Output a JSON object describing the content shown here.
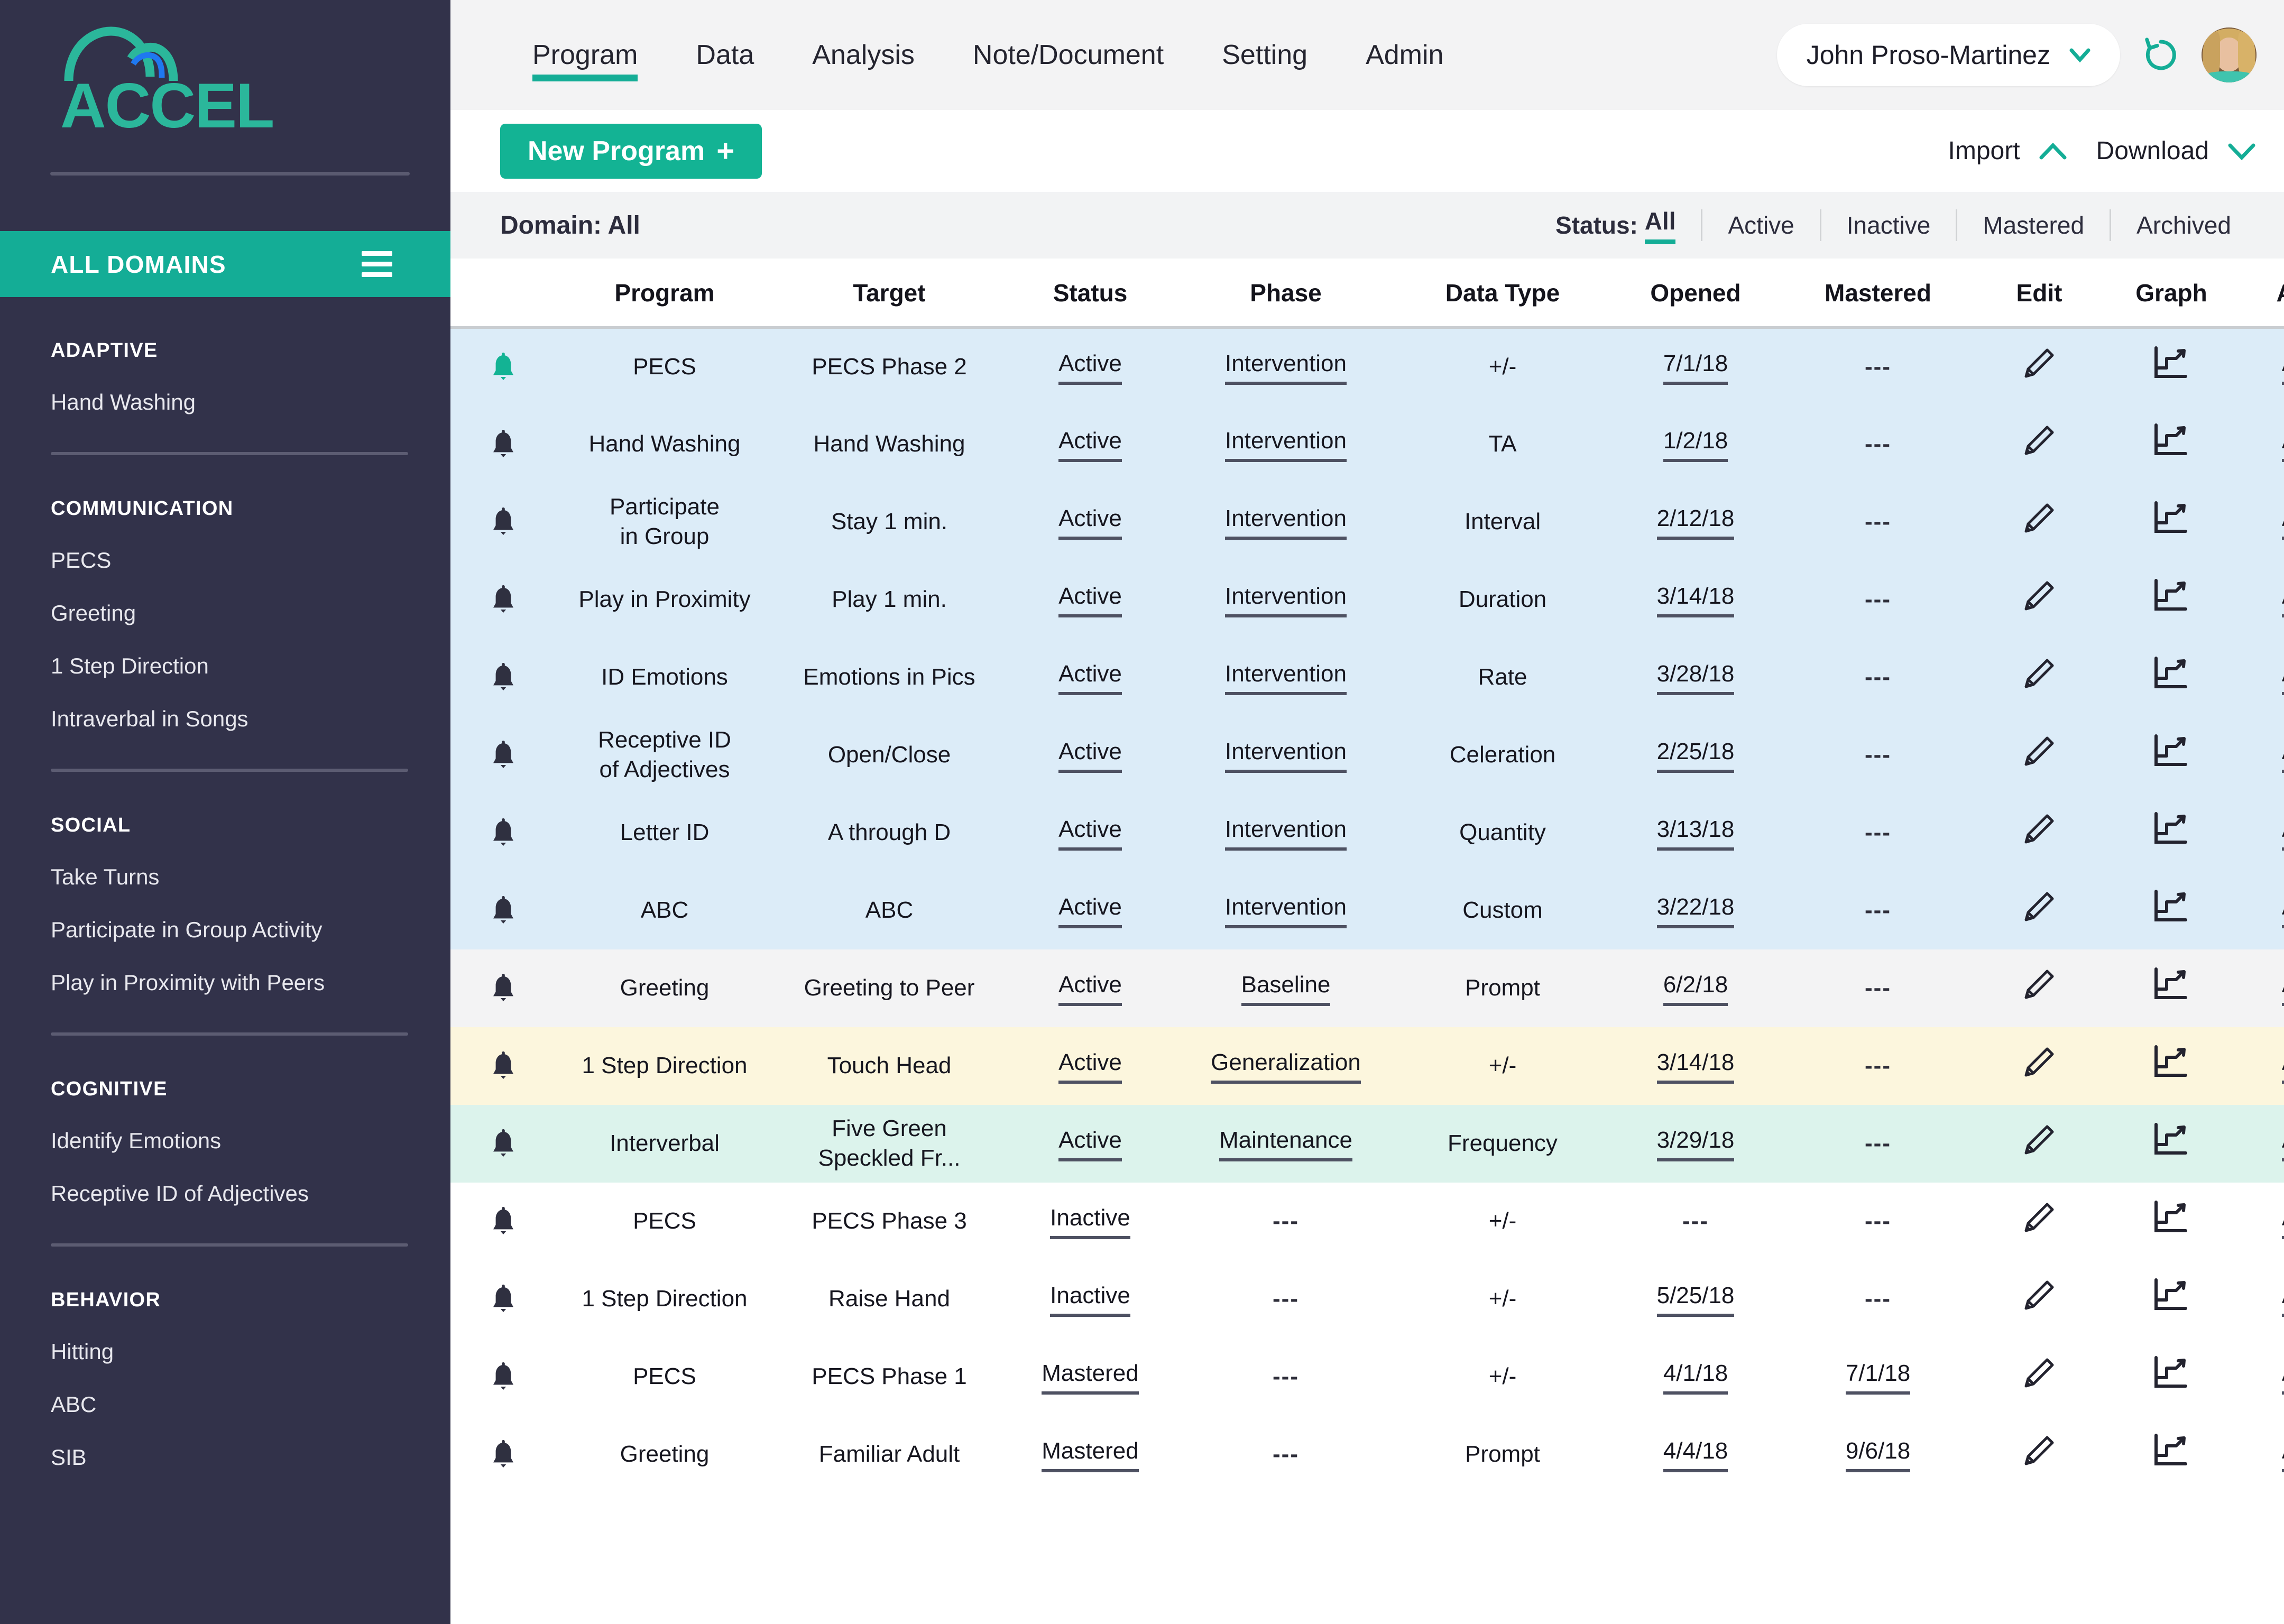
{
  "brand": {
    "name": "ACCEL"
  },
  "sidebar": {
    "all_domains_label": "ALL DOMAINS",
    "groups": [
      {
        "title": "ADAPTIVE",
        "items": [
          "Hand Washing"
        ]
      },
      {
        "title": "COMMUNICATION",
        "items": [
          "PECS",
          "Greeting",
          "1 Step Direction",
          "Intraverbal in Songs"
        ]
      },
      {
        "title": "SOCIAL",
        "items": [
          "Take Turns",
          "Participate in Group Activity",
          "Play in Proximity with Peers"
        ]
      },
      {
        "title": "COGNITIVE",
        "items": [
          "Identify Emotions",
          "Receptive ID of Adjectives"
        ]
      },
      {
        "title": "BEHAVIOR",
        "items": [
          "Hitting",
          "ABC",
          "SIB"
        ]
      }
    ]
  },
  "topnav": {
    "tabs": [
      {
        "label": "Program",
        "active": true
      },
      {
        "label": "Data",
        "active": false
      },
      {
        "label": "Analysis",
        "active": false
      },
      {
        "label": "Note/Document",
        "active": false
      },
      {
        "label": "Setting",
        "active": false
      },
      {
        "label": "Admin",
        "active": false
      }
    ],
    "user_name": "John Proso-Martinez"
  },
  "toolbar": {
    "new_program_label": "New Program",
    "new_program_plus": "+",
    "import_label": "Import",
    "download_label": "Download"
  },
  "filters": {
    "domain_label": "Domain: All",
    "status_prefix": "Status:",
    "status_selected": "All",
    "status_options": [
      "Active",
      "Inactive",
      "Mastered",
      "Archived"
    ]
  },
  "table": {
    "columns": [
      "",
      "Program",
      "Target",
      "Status",
      "Phase",
      "Data Type",
      "Opened",
      "Mastered",
      "Edit",
      "Graph",
      "Action"
    ],
    "action_label": "Action",
    "empty_value": "---",
    "rows": [
      {
        "row_style": "r-intervention",
        "bell": "active",
        "program": "PECS",
        "target": "PECS Phase 2",
        "status": "Active",
        "phase": "Intervention",
        "data_type": "+/-",
        "opened": "7/1/18",
        "mastered": "---"
      },
      {
        "row_style": "r-intervention",
        "bell": "normal",
        "program": "Hand Washing",
        "target": "Hand Washing",
        "status": "Active",
        "phase": "Intervention",
        "data_type": "TA",
        "opened": "1/2/18",
        "mastered": "---"
      },
      {
        "row_style": "r-intervention",
        "bell": "normal",
        "program": "Participate\nin Group",
        "target": "Stay 1 min.",
        "status": "Active",
        "phase": "Intervention",
        "data_type": "Interval",
        "opened": "2/12/18",
        "mastered": "---"
      },
      {
        "row_style": "r-intervention",
        "bell": "normal",
        "program": "Play in Proximity",
        "target": "Play 1 min.",
        "status": "Active",
        "phase": "Intervention",
        "data_type": "Duration",
        "opened": "3/14/18",
        "mastered": "---"
      },
      {
        "row_style": "r-intervention",
        "bell": "normal",
        "program": "ID Emotions",
        "target": "Emotions in Pics",
        "status": "Active",
        "phase": "Intervention",
        "data_type": "Rate",
        "opened": "3/28/18",
        "mastered": "---"
      },
      {
        "row_style": "r-intervention",
        "bell": "normal",
        "program": "Receptive ID\nof Adjectives",
        "target": "Open/Close",
        "status": "Active",
        "phase": "Intervention",
        "data_type": "Celeration",
        "opened": "2/25/18",
        "mastered": "---"
      },
      {
        "row_style": "r-intervention",
        "bell": "normal",
        "program": "Letter ID",
        "target": "A through D",
        "status": "Active",
        "phase": "Intervention",
        "data_type": "Quantity",
        "opened": "3/13/18",
        "mastered": "---"
      },
      {
        "row_style": "r-intervention",
        "bell": "normal",
        "program": "ABC",
        "target": "ABC",
        "status": "Active",
        "phase": "Intervention",
        "data_type": "Custom",
        "opened": "3/22/18",
        "mastered": "---"
      },
      {
        "row_style": "r-baseline",
        "bell": "normal",
        "program": "Greeting",
        "target": "Greeting to Peer",
        "status": "Active",
        "phase": "Baseline",
        "data_type": "Prompt",
        "opened": "6/2/18",
        "mastered": "---"
      },
      {
        "row_style": "r-generalization",
        "bell": "normal",
        "program": "1 Step Direction",
        "target": "Touch Head",
        "status": "Active",
        "phase": "Generalization",
        "data_type": "+/-",
        "opened": "3/14/18",
        "mastered": "---"
      },
      {
        "row_style": "r-maintenance",
        "bell": "normal",
        "program": "Interverbal",
        "target": "Five Green\nSpeckled Fr...",
        "status": "Active",
        "phase": "Maintenance",
        "data_type": "Frequency",
        "opened": "3/29/18",
        "mastered": "---"
      },
      {
        "row_style": "r-plain",
        "bell": "normal",
        "program": "PECS",
        "target": "PECS Phase 3",
        "status": "Inactive",
        "phase": "---",
        "data_type": "+/-",
        "opened": "---",
        "mastered": "---"
      },
      {
        "row_style": "r-plain",
        "bell": "normal",
        "program": "1 Step Direction",
        "target": "Raise Hand",
        "status": "Inactive",
        "phase": "---",
        "data_type": "+/-",
        "opened": "5/25/18",
        "mastered": "---"
      },
      {
        "row_style": "r-plain",
        "bell": "normal",
        "program": "PECS",
        "target": "PECS Phase 1",
        "status": "Mastered",
        "phase": "---",
        "data_type": "+/-",
        "opened": "4/1/18",
        "mastered": "7/1/18"
      },
      {
        "row_style": "r-plain",
        "bell": "normal",
        "program": "Greeting",
        "target": "Familiar Adult",
        "status": "Mastered",
        "phase": "---",
        "data_type": "Prompt",
        "opened": "4/4/18",
        "mastered": "9/6/18"
      }
    ]
  },
  "colors": {
    "teal": "#14ad96",
    "teal_button": "#13b394",
    "sidebar_bg": "#32324a",
    "row_intervention": "#dcecf8",
    "row_baseline": "#f3f3f4",
    "row_generalization": "#fcf6dd",
    "row_maintenance": "#dcf3ec"
  }
}
